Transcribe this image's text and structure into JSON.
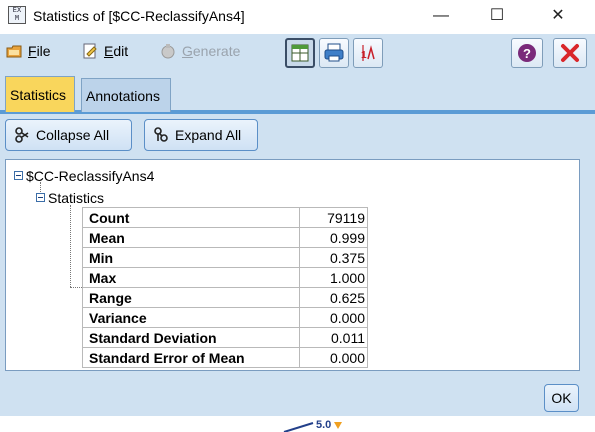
{
  "window": {
    "title": "Statistics of [$CC-ReclassifyAns4]",
    "icon_text": "EX\nM",
    "minimize_glyph": "—",
    "maximize_glyph": "☐",
    "close_glyph": "✕"
  },
  "menu": {
    "file_label": "File",
    "file_ul": "F",
    "edit_label": "Edit",
    "edit_ul": "E",
    "generate_label": "Generate",
    "generate_ul": "G",
    "edge_glyph": "le"
  },
  "tabs": [
    {
      "label": "Statistics",
      "selected": true
    },
    {
      "label": "Annotations",
      "selected": false
    }
  ],
  "actions": {
    "collapse_label": "Collapse All",
    "expand_label": "Expand All"
  },
  "tree": {
    "root_label": "$CC-ReclassifyAns4",
    "child_label": "Statistics"
  },
  "stats": [
    {
      "label": "Count",
      "value": "79119"
    },
    {
      "label": "Mean",
      "value": "0.999"
    },
    {
      "label": "Min",
      "value": "0.375"
    },
    {
      "label": "Max",
      "value": "1.000"
    },
    {
      "label": "Range",
      "value": "0.625"
    },
    {
      "label": "Variance",
      "value": "0.000"
    },
    {
      "label": "Standard Deviation",
      "value": "0.011"
    },
    {
      "label": "Standard Error of Mean",
      "value": "0.000"
    }
  ],
  "ok_label": "OK",
  "background_label": "5.0",
  "colors": {
    "accent": "#5b9bd5",
    "selected_tab": "#f9d65c",
    "panel": "#cfe1f1",
    "close_red": "#d9262a"
  }
}
